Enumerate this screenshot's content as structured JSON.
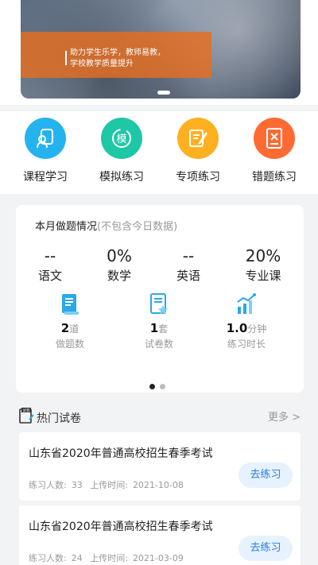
{
  "banner": {
    "line1": "助力学生乐学，教师易教，",
    "line2": "学校教学质量提升"
  },
  "quick_menu": [
    {
      "label": "课程学习",
      "icon": "course-icon",
      "color": "#25b3f0"
    },
    {
      "label": "模拟练习",
      "icon": "mock-icon",
      "color": "#1ec7a6"
    },
    {
      "label": "专项练习",
      "icon": "special-icon",
      "color": "#ffb020"
    },
    {
      "label": "错题练习",
      "icon": "wrong-icon",
      "color": "#ff6a33"
    }
  ],
  "stats": {
    "title": "本月做题情况",
    "subtitle": "(不包含今日数据)",
    "subjects": [
      {
        "value": "--",
        "name": "语文"
      },
      {
        "value": "0%",
        "name": "数学"
      },
      {
        "value": "--",
        "name": "英语"
      },
      {
        "value": "20%",
        "name": "专业课"
      }
    ],
    "metrics": [
      {
        "value": "2",
        "unit": "道",
        "label": "做题数",
        "icon": "document-list-icon"
      },
      {
        "value": "1",
        "unit": "套",
        "label": "试卷数",
        "icon": "paper-star-icon"
      },
      {
        "value": "1.0",
        "unit": "分钟",
        "label": "练习时长",
        "icon": "growth-chart-icon"
      }
    ],
    "page": {
      "current": 1,
      "total": 2
    }
  },
  "hot": {
    "title": "热门试卷",
    "more": "更多 >",
    "papers": [
      {
        "title": "山东省2020年普通高校招生春季考试",
        "count_label": "练习人数:",
        "count": "33",
        "time_label": "上传时间:",
        "time": "2021-10-08",
        "button": "去练习"
      },
      {
        "title": "山东省2020年普通高校招生春季考试",
        "count_label": "练习人数:",
        "count": "24",
        "time_label": "上传时间:",
        "time": "2021-03-09",
        "button": "去练习"
      }
    ]
  },
  "colors": {
    "accent": "#2a7de1",
    "accent_bg": "#e6f2ff",
    "muted": "#999999"
  }
}
